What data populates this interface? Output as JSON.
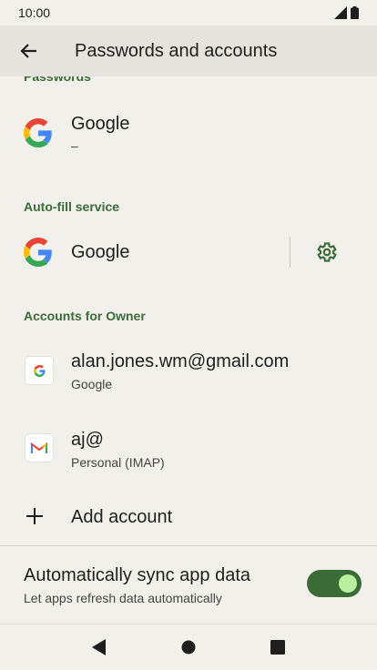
{
  "status_bar": {
    "time": "10:00"
  },
  "app_bar": {
    "title": "Passwords and accounts"
  },
  "sections": {
    "passwords": {
      "header": "Passwords",
      "item": {
        "title": "Google",
        "subtitle": "–"
      }
    },
    "autofill": {
      "header": "Auto-fill service",
      "item": {
        "title": "Google"
      }
    },
    "accounts": {
      "header": "Accounts for Owner",
      "items": [
        {
          "title": "alan.jones.wm@gmail.com",
          "subtitle": "Google",
          "icon": "google-icon"
        },
        {
          "title": "aj@",
          "subtitle": "Personal (IMAP)",
          "icon": "gmail-icon"
        }
      ],
      "add_label": "Add account"
    }
  },
  "sync": {
    "title": "Automatically sync app data",
    "subtitle": "Let apps refresh data automatically",
    "enabled": true
  },
  "colors": {
    "accent": "#3b6b37",
    "background": "#f1f0ea",
    "app_bar": "#e4e3dd"
  }
}
